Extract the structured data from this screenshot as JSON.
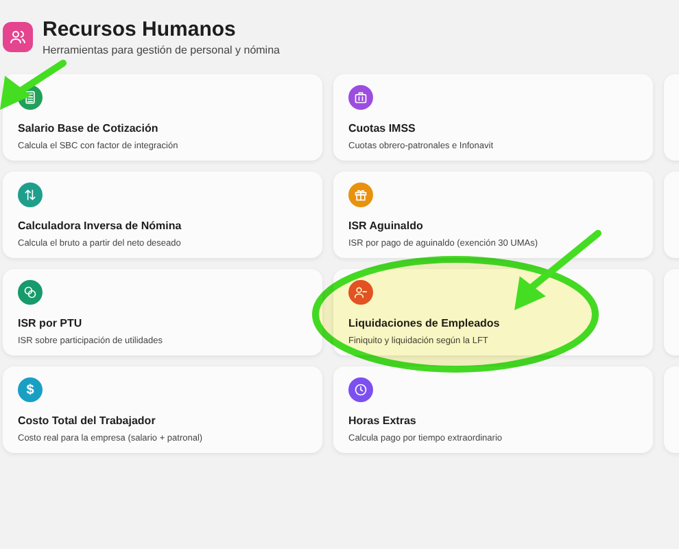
{
  "header": {
    "title": "Recursos Humanos",
    "subtitle": "Herramientas para gestión de personal y nómina"
  },
  "cards": [
    {
      "title": "Salario Base de Cotización",
      "description": "Calcula el SBC con factor de integración",
      "color": "#22a05a"
    },
    {
      "title": "Cuotas IMSS",
      "description": "Cuotas obrero-patronales e Infonavit",
      "color": "#9b4de0"
    },
    {
      "title": "Calculadora Inversa de Nómina",
      "description": "Calcula el bruto a partir del neto deseado",
      "color": "#1f9e8c"
    },
    {
      "title": "ISR Aguinaldo",
      "description": "ISR por pago de aguinaldo (exención 30 UMAs)",
      "color": "#e8920e"
    },
    {
      "title": "ISR por PTU",
      "description": "ISR sobre participación de utilidades",
      "color": "#179a6c"
    },
    {
      "title": "Liquidaciones de Empleados",
      "description": "Finiquito y liquidación según la LFT",
      "color": "#e5532d"
    },
    {
      "title": "Costo Total del Trabajador",
      "description": "Costo real para la empresa (salario + patronal)",
      "glyph": "$",
      "color": "#1a9fc4"
    },
    {
      "title": "Horas Extras",
      "description": "Calcula pago por tiempo extraordinario",
      "color": "#7c4ff0"
    }
  ],
  "annotations": [
    {
      "kind": "arrow"
    },
    {
      "kind": "ellipse"
    },
    {
      "kind": "arrow"
    }
  ]
}
